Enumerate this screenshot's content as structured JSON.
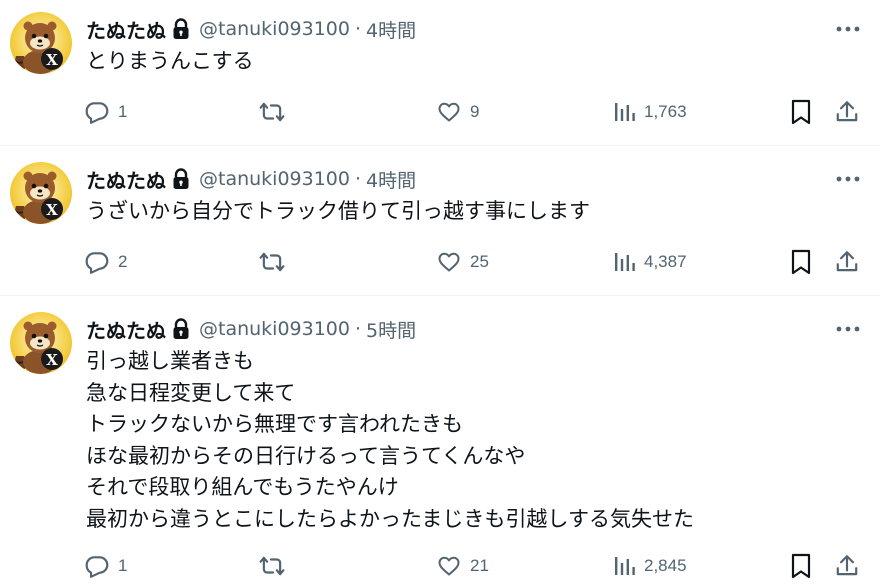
{
  "tweets": [
    {
      "name": "たぬたぬ",
      "handle": "@tanuki093100",
      "separator": "·",
      "time": "4時間",
      "lines": [
        "とりまうんこする"
      ],
      "replies": "1",
      "likes": "9",
      "views": "1,763"
    },
    {
      "name": "たぬたぬ",
      "handle": "@tanuki093100",
      "separator": "·",
      "time": "4時間",
      "lines": [
        "うざいから自分でトラック借りて引っ越す事にします"
      ],
      "replies": "2",
      "likes": "25",
      "views": "4,387"
    },
    {
      "name": "たぬたぬ",
      "handle": "@tanuki093100",
      "separator": "·",
      "time": "5時間",
      "lines": [
        "引っ越し業者きも",
        "急な日程変更して来て",
        "トラックないから無理です言われたきも",
        "ほな最初からその日行けるって言うてくんなや",
        "それで段取り組んでもうたやんけ",
        "最初から違うとこにしたらよかったまじきも引越しする気失せた"
      ],
      "replies": "1",
      "likes": "21",
      "views": "2,845"
    }
  ],
  "colors": {
    "text": "#0f1419",
    "muted": "#536471",
    "divider": "#eff3f4",
    "avatar": "#f3cc3e"
  },
  "icons": [
    "lock-icon",
    "more-icon",
    "reply-icon",
    "retweet-icon",
    "like-icon",
    "views-icon",
    "bookmark-icon",
    "share-icon"
  ]
}
